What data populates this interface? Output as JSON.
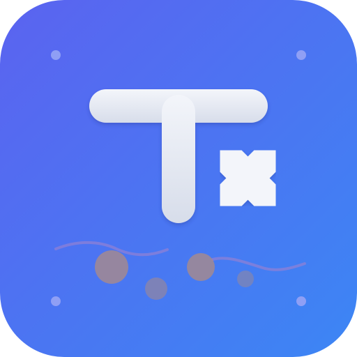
{
  "app_icon": {
    "semantic": "clear-formatting-icon",
    "symbol": "Tx",
    "colors": {
      "gradient_start": "#5B63F0",
      "gradient_end": "#3C86F4",
      "glyph": "#F3F5FA",
      "glyph_shade": "#D7DDEA",
      "wave": "#8E80D6",
      "bubble": "#A98B89",
      "dot": "#8F9FF5"
    }
  }
}
